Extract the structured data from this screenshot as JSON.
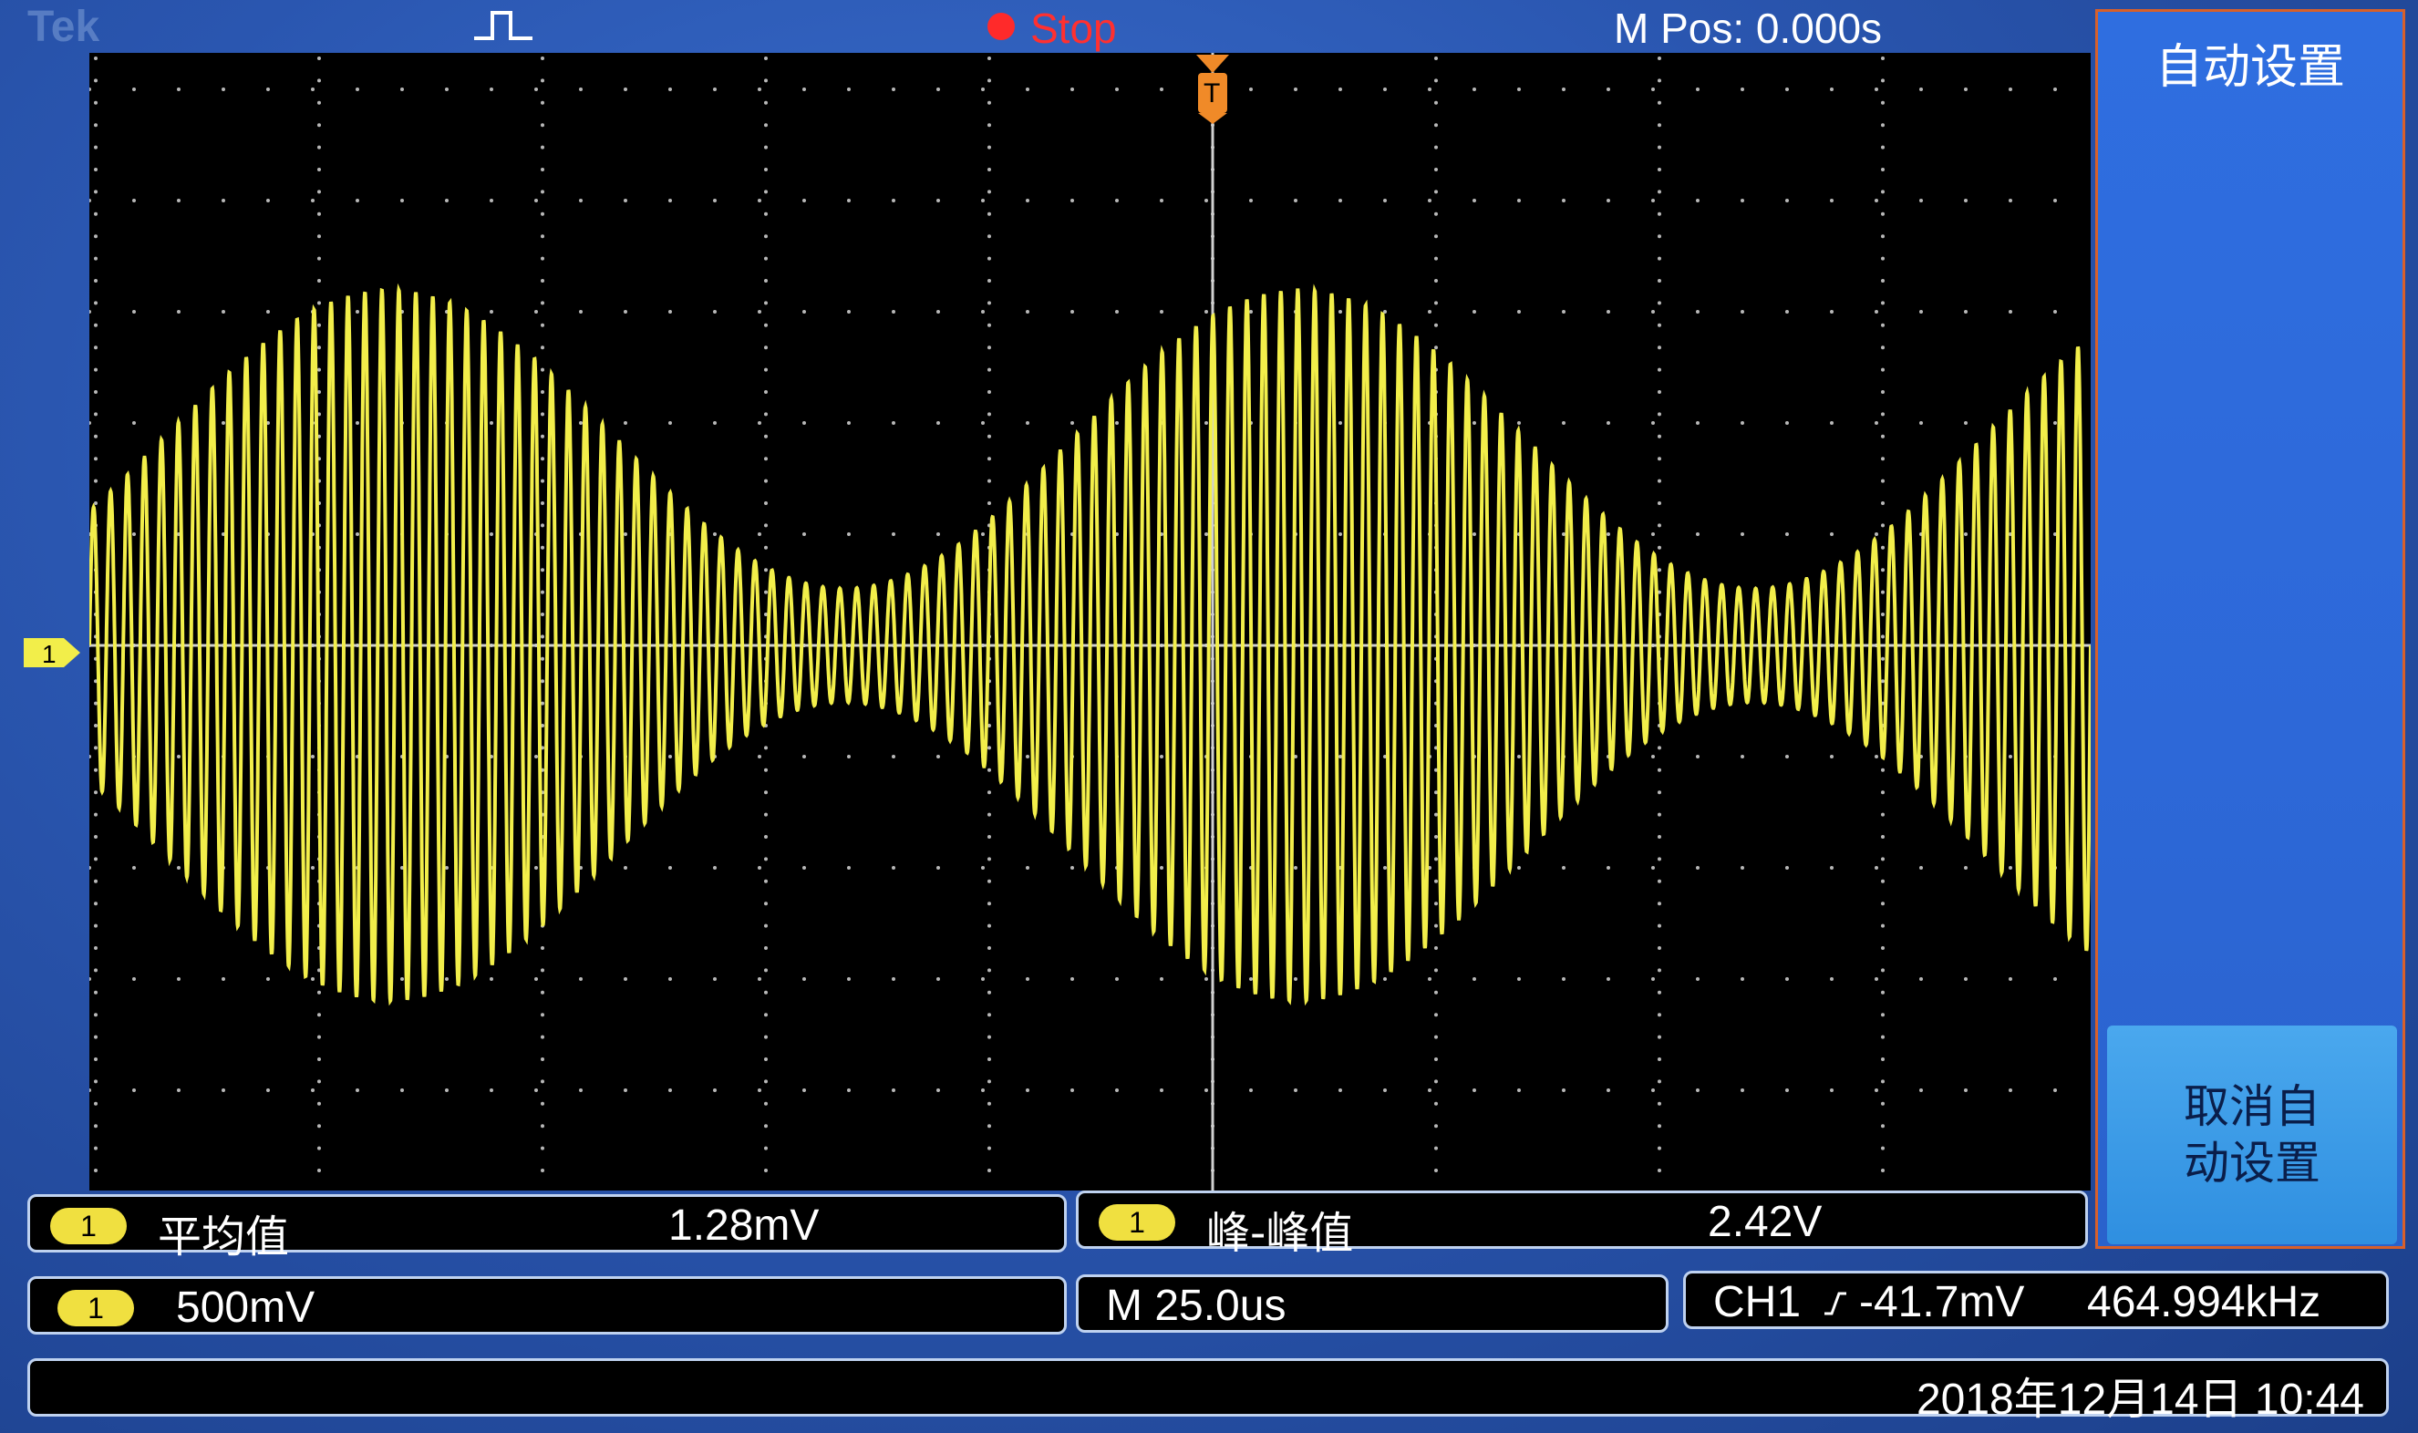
{
  "header": {
    "brand": "Tek",
    "trigger_icon": "pulse-trigger-icon",
    "run_state": "Stop",
    "m_pos": "M Pos: 0.000s"
  },
  "side_menu": {
    "title": "自动设置",
    "cancel_button": "取消自 动设置"
  },
  "channel_marker": "1",
  "trigger_marker": "T",
  "measurements": {
    "mean": {
      "channel": "1",
      "label": "平均值",
      "value": "1.28mV"
    },
    "peak_to_peak": {
      "channel": "1",
      "label": "峰-峰值",
      "value": "2.42V"
    }
  },
  "settings": {
    "ch1_scale": {
      "channel": "1",
      "value": "500mV"
    },
    "timebase": "M 25.0us",
    "trigger": {
      "source": "CH1",
      "level": "-41.7mV",
      "frequency": "464.994kHz"
    }
  },
  "datetime": "2018年12月14日 10:44",
  "colors": {
    "waveform": "#f2ee4a",
    "background": "#000000",
    "bezel": "#2a5cc0",
    "stop": "#ff3030",
    "trigger_marker": "#f08a28"
  },
  "waveform": {
    "carrier_cycles_visible": 118,
    "envelope_periods_visible": 2.2,
    "peak_to_peak_V": 2.42
  }
}
